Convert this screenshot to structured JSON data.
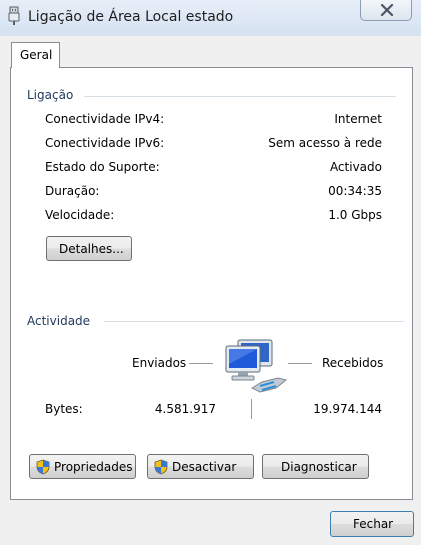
{
  "window": {
    "title": "Ligação de Área Local estado"
  },
  "tabs": [
    {
      "label": "Geral",
      "selected": true
    }
  ],
  "ligacao": {
    "heading": "Ligação",
    "rows": [
      {
        "label": "Conectividade IPv4:",
        "value": "Internet"
      },
      {
        "label": "Conectividade IPv6:",
        "value": "Sem acesso à rede"
      },
      {
        "label": "Estado do Suporte:",
        "value": "Activado"
      },
      {
        "label": "Duração:",
        "value": "00:34:35"
      },
      {
        "label": "Velocidade:",
        "value": "1.0 Gbps"
      }
    ],
    "details_button": "Detalhes..."
  },
  "actividade": {
    "heading": "Actividade",
    "sent_label": "Enviados",
    "received_label": "Recebidos",
    "bytes_label": "Bytes:",
    "bytes_sent": "4.581.917",
    "bytes_received": "19.974.144"
  },
  "buttons": {
    "properties": "Propriedades",
    "deactivate": "Desactivar",
    "diagnose": "Diagnosticar",
    "close": "Fechar"
  },
  "icons": {
    "title": "network-adapter-icon",
    "window_close": "close-icon",
    "activity": "network-computers-icon",
    "uac": "uac-shield-icon"
  },
  "colors": {
    "title_bar": "#dbe5f2",
    "panel": "#ffffff",
    "dialog": "#f0f0f0",
    "group_heading": "#1e395b"
  }
}
